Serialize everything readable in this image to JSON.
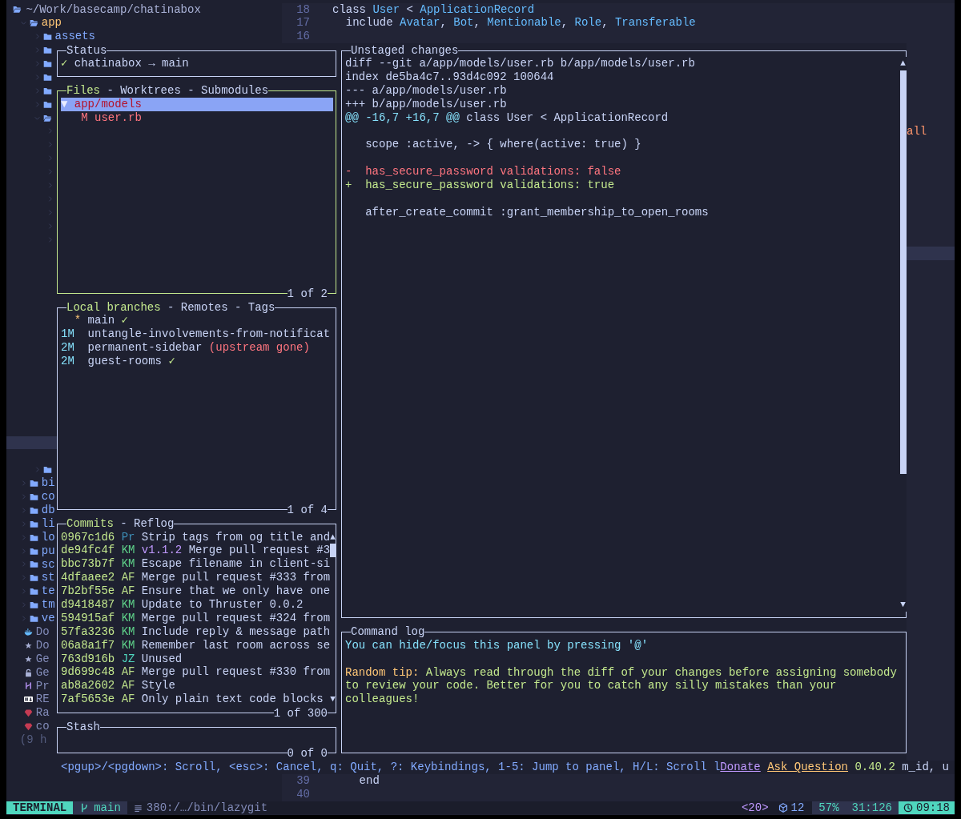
{
  "file_tree": {
    "root": "~/Work/basecamp/chatinabox",
    "cursor_line": true,
    "items": [
      {
        "name": "app",
        "kind": "dir",
        "expanded": true,
        "children": [
          {
            "name": "assets",
            "kind": "dir",
            "expanded": false
          },
          {
            "kind": "dir",
            "expanded": false
          },
          {
            "kind": "dir",
            "expanded": false
          },
          {
            "kind": "dir",
            "expanded": false
          },
          {
            "kind": "dir",
            "expanded": false
          },
          {
            "kind": "dir",
            "expanded": false
          },
          {
            "kind": "dir",
            "expanded": true,
            "children": [
              {
                "kind": "dir",
                "expanded": false
              },
              {
                "kind": "dir",
                "expanded": false
              },
              {
                "kind": "dir",
                "expanded": false
              },
              {
                "kind": "dir",
                "expanded": false
              },
              {
                "kind": "dir",
                "expanded": false
              },
              {
                "kind": "dir",
                "expanded": false
              },
              {
                "kind": "dir",
                "expanded": false
              },
              {
                "kind": "dir",
                "expanded": false
              },
              {
                "kind": "dir",
                "expanded": false
              }
            ]
          },
          {
            "kind": "dir",
            "expanded": false
          }
        ]
      },
      {
        "name": "bi",
        "kind": "dir",
        "expanded": false
      },
      {
        "name": "co",
        "kind": "dir",
        "expanded": false
      },
      {
        "name": "db",
        "kind": "dir",
        "expanded": false
      },
      {
        "name": "li",
        "kind": "dir",
        "expanded": false
      },
      {
        "name": "lo",
        "kind": "dir",
        "expanded": false
      },
      {
        "name": "pu",
        "kind": "dir",
        "expanded": false
      },
      {
        "name": "sc",
        "kind": "dir",
        "expanded": false
      },
      {
        "name": "st",
        "kind": "dir",
        "expanded": false
      },
      {
        "name": "te",
        "kind": "dir",
        "expanded": false
      },
      {
        "name": "tm",
        "kind": "dir",
        "expanded": false
      },
      {
        "name": "ve",
        "kind": "dir",
        "expanded": false
      },
      {
        "name": "Do",
        "kind": "docker"
      },
      {
        "name": "Do",
        "kind": "star"
      },
      {
        "name": "Ge",
        "kind": "star"
      },
      {
        "name": "Ge",
        "kind": "lock"
      },
      {
        "name": "Pr",
        "kind": "git"
      },
      {
        "name": "RE",
        "kind": "markdown"
      },
      {
        "name": "Ra",
        "kind": "ruby"
      },
      {
        "name": "co",
        "kind": "ruby"
      }
    ],
    "footer": "(9 h"
  },
  "editor": {
    "top_lines": [
      {
        "number": "18",
        "tokens": [
          {
            "text": "class ",
            "constant": false
          },
          {
            "text": "User",
            "constant": true
          },
          {
            "text": " < ",
            "constant": false
          },
          {
            "text": "ApplicationRecord",
            "constant": true
          }
        ]
      },
      {
        "number": "17",
        "tokens": [
          {
            "text": "  include ",
            "constant": false
          },
          {
            "text": "Avatar",
            "constant": true
          },
          {
            "text": ", ",
            "constant": false
          },
          {
            "text": "Bot",
            "constant": true
          },
          {
            "text": ", ",
            "constant": false
          },
          {
            "text": "Mentionable",
            "constant": true
          },
          {
            "text": ", ",
            "constant": false
          },
          {
            "text": "Role",
            "constant": true
          },
          {
            "text": ", ",
            "constant": false
          },
          {
            "text": "Transferable",
            "constant": true
          }
        ]
      },
      {
        "number": "16"
      }
    ],
    "right_fragment": "all",
    "cursor_line": true,
    "trailing_fragment": "m_id, u",
    "bottom_lines": [
      {
        "number": "39",
        "tokens": [
          {
            "text": "    end",
            "constant": false
          }
        ]
      },
      {
        "number": "40"
      }
    ]
  },
  "lazygit": {
    "status": {
      "title": "Status",
      "focused": false,
      "mark": "✓",
      "text": "chatinabox → main"
    },
    "files": {
      "focused": true,
      "separator": "-",
      "tabs": [
        {
          "label": "Files",
          "selected": true
        },
        {
          "label": "Worktrees",
          "selected": false
        },
        {
          "label": "Submodules",
          "selected": false
        }
      ],
      "rows": [
        {
          "toggle": "▼",
          "path": "app/models",
          "selected": true,
          "children": [
            {
              "status": "M",
              "path": "user.rb",
              "selected": false
            }
          ]
        }
      ],
      "footer": "1 of 2"
    },
    "branches": {
      "focused": false,
      "separator": "-",
      "tabs": [
        {
          "label": "Local branches",
          "selected": true
        },
        {
          "label": "Remotes",
          "selected": false
        },
        {
          "label": "Tags",
          "selected": false
        }
      ],
      "rows": [
        {
          "recency": "*",
          "head": true,
          "name": "main",
          "upstream": "✓",
          "upstream_gone": false
        },
        {
          "recency": "1M",
          "head": false,
          "name": "untangle-involvements-from-notificat"
        },
        {
          "recency": "2M",
          "head": false,
          "name": "permanent-sidebar",
          "upstream": "(upstream gone)",
          "upstream_gone": true
        },
        {
          "recency": "2M",
          "head": false,
          "name": "guest-rooms",
          "upstream": "✓",
          "upstream_gone": false
        }
      ],
      "footer": "1 of 4"
    },
    "commits": {
      "focused": false,
      "separator": "-",
      "tabs": [
        {
          "label": "Commits",
          "selected": true
        },
        {
          "label": "Reflog",
          "selected": false
        }
      ],
      "rows": [
        {
          "hash": "0967c1d6",
          "author": "Pr",
          "color": "#3d8fb8",
          "subject": "Strip tags from og title and"
        },
        {
          "hash": "de94fc4f",
          "author": "KM",
          "color": "#5fd38a",
          "tag": "v1.1.2",
          "subject": "Merge pull request #3"
        },
        {
          "hash": "bbc73b7f",
          "author": "KM",
          "color": "#5fd38a",
          "subject": "Escape filename in client-si"
        },
        {
          "hash": "4dfaaee2",
          "author": "AF",
          "color": "#b8db87",
          "subject": "Merge pull request #333 from"
        },
        {
          "hash": "7b2bf55e",
          "author": "AF",
          "color": "#b8db87",
          "subject": "Ensure that we only have one"
        },
        {
          "hash": "d9418487",
          "author": "KM",
          "color": "#5fd38a",
          "subject": "Update to Thruster 0.0.2"
        },
        {
          "hash": "594915af",
          "author": "KM",
          "color": "#5fd38a",
          "subject": "Merge pull request #324 from"
        },
        {
          "hash": "57fa3236",
          "author": "KM",
          "color": "#5fd38a",
          "subject": "Include reply & message path"
        },
        {
          "hash": "06a8a1f7",
          "author": "KM",
          "color": "#5fd38a",
          "subject": "Remember last room across se"
        },
        {
          "hash": "763d916b",
          "author": "JZ",
          "color": "#4fd6be",
          "subject": "Unused"
        },
        {
          "hash": "9d699c48",
          "author": "AF",
          "color": "#b8db87",
          "subject": "Merge pull request #330 from"
        },
        {
          "hash": "ab8a2602",
          "author": "AF",
          "color": "#b8db87",
          "subject": "Style"
        },
        {
          "hash": "7af5653e",
          "author": "AF",
          "color": "#b8db87",
          "subject": "Only plain text code blocks"
        }
      ],
      "scroll_up": "▲",
      "scroll_down": "▼",
      "footer": "1 of 300"
    },
    "stash": {
      "title": "Stash",
      "focused": false,
      "footer": "0 of 0"
    },
    "diff": {
      "title": "Unstaged changes",
      "focused": false,
      "scroll_up": "▲",
      "scroll_down": "▼",
      "lines": [
        {
          "kind": "meta",
          "text": "diff --git a/app/models/user.rb b/app/models/user.rb"
        },
        {
          "kind": "meta",
          "text": "index de5ba4c7..93d4c092 100644"
        },
        {
          "kind": "meta",
          "text": "--- a/app/models/user.rb"
        },
        {
          "kind": "meta",
          "text": "+++ b/app/models/user.rb"
        },
        {
          "kind": "hunk",
          "range": "@@ -16,7 +16,7 @@",
          "text": "class User < ApplicationRecord"
        },
        {
          "kind": "blank"
        },
        {
          "kind": "context",
          "text": "   scope :active, -> { where(active: true) }"
        },
        {
          "kind": "blank"
        },
        {
          "kind": "removed",
          "text": "-  has_secure_password validations: false"
        },
        {
          "kind": "added",
          "text": "+  has_secure_password validations: true"
        },
        {
          "kind": "blank"
        },
        {
          "kind": "context",
          "text": "   after_create_commit :grant_membership_to_open_rooms"
        }
      ]
    },
    "command_log": {
      "title": "Command log",
      "focused": false,
      "lines": [
        {
          "kind": "info",
          "text": "You can hide/focus this panel by pressing '@'"
        },
        {
          "kind": "blank"
        },
        {
          "kind": "tip",
          "label": "Random tip:",
          "text": "Always read through the diff of your changes before assigning somebody to review your code. Better for you to catch any silly mistakes than your colleagues!"
        }
      ]
    },
    "help": {
      "keys": "<pgup>/<pgdown>: Scroll, <esc>: Cancel, q: Quit, ?: Keybindings, 1-5: Jump to panel, H/L: Scroll l",
      "links": [
        {
          "kind": "donate",
          "text": "Donate"
        },
        {
          "kind": "ask",
          "text": "Ask Question"
        }
      ],
      "version": "0.40.2"
    }
  },
  "status_bar": {
    "mode": "TERMINAL",
    "branch": "main",
    "file": "380:/…/bin/lazygit",
    "counter": "<20>",
    "count": "12",
    "percent": "57%",
    "position": "31:126",
    "time": "09:18"
  }
}
